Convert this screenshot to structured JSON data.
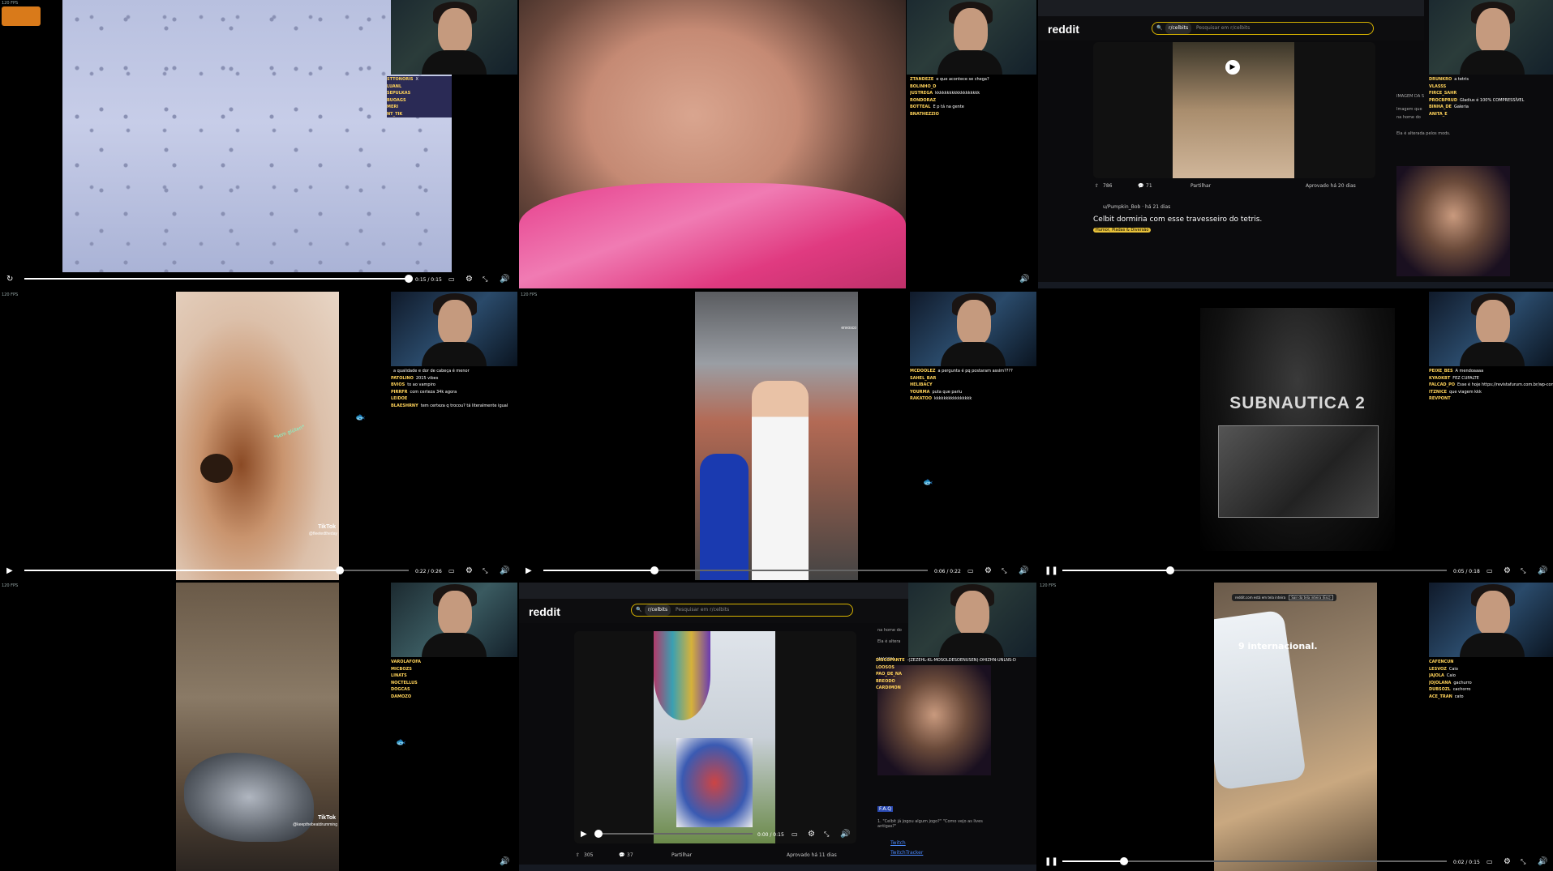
{
  "fps": "120 FPS",
  "tiles": [
    {
      "time": "0:15 / 0:15",
      "progress": 1.0,
      "chat": [
        [
          "STTONORIS",
          "X"
        ],
        [
          "LUANL",
          ""
        ],
        [
          "SEPULKAS",
          ""
        ],
        [
          "BUOAGS",
          ""
        ],
        [
          "MERI",
          ""
        ],
        [
          "NT_TIK",
          ""
        ]
      ]
    },
    {
      "chat": [
        [
          "ZTANDEZE",
          "e que acontece se chega?"
        ],
        [
          "BOLINHO_D",
          ""
        ],
        [
          "JUSTREGA",
          "kkkkkkkkkkkkkkkkkkk"
        ],
        [
          "RONDORAZ",
          ""
        ],
        [
          "BOTTEAL",
          "E p tá na gente"
        ],
        [
          "BNATHEZZIO",
          ""
        ]
      ]
    },
    {
      "reddit_logo": "reddit",
      "chip": "r/celbits",
      "search_placeholder": "Pesquisar em r/celbits",
      "upvotes": "786",
      "comments": "71",
      "share": "Partilhar",
      "approved": "Aprovado há 20 dias",
      "post_user": "u/Pumpkin_Bob · há 21 dias",
      "post_title": "Celbit dormiria com esse travesseiro do tetris.",
      "flair": "Humor, Piadas & Diversão",
      "side1": "IMAGEM DA S",
      "side2": "Imagem que",
      "side3": "na home do",
      "side4": "Ela é alterada pelos mods.",
      "chat": [
        [
          "DRUNKRO",
          "a tetris"
        ],
        [
          "VLASSS",
          ""
        ],
        [
          "FIRCE_SAHR",
          ""
        ],
        [
          "PROCBPRUD",
          "Gladius é 100% COMPRESSÍVEL"
        ],
        [
          "BINHA_DE",
          "Galeria"
        ],
        [
          "ANITA_E",
          ""
        ]
      ]
    },
    {
      "time": "0:22 / 0:26",
      "progress": 0.82,
      "tiktok": "TikTok",
      "tiktok_user": "@fleetedtheday",
      "overlay": "*sem glúten*",
      "chat": [
        [
          "",
          "a qualidade e dor de cabeça é menor"
        ],
        [
          "PATOLINO",
          "2015 vibes"
        ],
        [
          "BVIOS",
          "to ao vampiro"
        ],
        [
          "PIRRFR",
          "com certeza 34k agora"
        ],
        [
          "LEIDOE",
          ""
        ],
        [
          "BLAESHRNY",
          "tem certeza q trocou? tá literalmente igual"
        ]
      ]
    },
    {
      "time": "0:06 / 0:22",
      "progress": 0.29,
      "watermark": "envosco",
      "chat": [
        [
          "MCDOOLEZ",
          "a pergunta é pq postaram assim????"
        ],
        [
          "SAHEL_BAR",
          ""
        ],
        [
          "HELIBACY",
          ""
        ],
        [
          "YOURMA",
          "puta que pariu"
        ],
        [
          "RAKATOO",
          "kkkkkkkkkkkkkkkk"
        ]
      ]
    },
    {
      "time": "0:05 / 0:18",
      "progress": 0.28,
      "title": "SUBNAUTICA 2",
      "chat": [
        [
          "PEIXE_BES",
          "A mendoaaaa"
        ],
        [
          "KYAOKBT",
          "FEZ CUPALTE"
        ],
        [
          "FALCAD_PO",
          "Esse é hoje https://revistafurum.com.br/wp-content/uploads/2025/10/michelos_skeleton.jpg"
        ],
        [
          "ITZNICE",
          "que viagem kkk"
        ],
        [
          "REVPONT",
          ""
        ]
      ]
    },
    {
      "tiktok": "TikTok",
      "tiktok_user": "@keepthebeatdrumming",
      "chat": [
        [
          "VAROLAFOFA",
          ""
        ],
        [
          "MICBOZS",
          ""
        ],
        [
          "LINATS",
          ""
        ],
        [
          "NOCTELLUS",
          ""
        ],
        [
          "DOGCAS",
          ""
        ],
        [
          "DAMOZO",
          ""
        ]
      ]
    },
    {
      "reddit_logo": "reddit",
      "chip": "r/celbits",
      "search_placeholder": "Pesquisar em r/celbits",
      "time": "0:00 / 0:15",
      "progress": 0.0,
      "upvotes": "305",
      "comments": "37",
      "share": "Partilhar",
      "approved": "Aprovado há 11 dias",
      "side1": "na home do",
      "side2": "Ela é altera",
      "side3": "IMAGEM",
      "faq_title": "F.A.Q",
      "faq_q": "1. \"Celbit já jogou algum jogo?\" \"Como vejo as lives antigas?\"",
      "faq_1": "Twitch",
      "faq_2": "TwitchTracker",
      "chat": [
        [
          "DISCOPANTE",
          "-(ZEZEHL-KL-MOSOLDESOENUSEN)-DHIZHN-UNLNS-D"
        ],
        [
          "LOOSOS",
          ""
        ],
        [
          "PAO_DE_NA",
          ""
        ],
        [
          "BREODO",
          ""
        ],
        [
          "CARDIMON",
          ""
        ]
      ]
    },
    {
      "time": "0:02 / 0:15",
      "progress": 0.16,
      "banner": "9 internacional.",
      "toast": "reddit.com está em tela inteira",
      "toast_btn": "Sair da tela inteira (Esc)",
      "chat": [
        [
          "CAFENCUN",
          ""
        ],
        [
          "LESVOZ",
          "Caio"
        ],
        [
          "JAJOLA",
          "Caio"
        ],
        [
          "JOJOLANA",
          "gachurro"
        ],
        [
          "DUBSOZL",
          "cachorro"
        ],
        [
          "ACE_TRAN",
          "cato"
        ]
      ]
    }
  ],
  "colors": {
    "accent_search": "#d8b400",
    "chat_user": "#ffd35a"
  }
}
